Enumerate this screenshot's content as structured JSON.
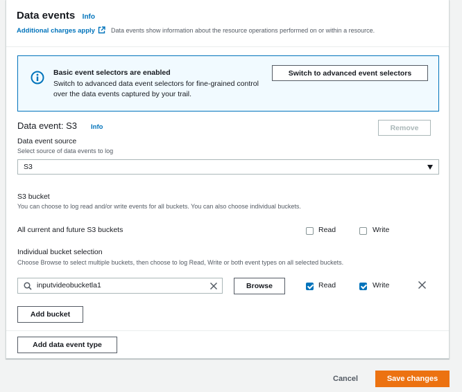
{
  "header": {
    "title": "Data events",
    "info": "Info",
    "charges_link": "Additional charges apply",
    "description": "Data events show information about the resource operations performed on or within a resource."
  },
  "alert": {
    "icon": "info-circle-icon",
    "title": "Basic event selectors are enabled",
    "body": "Switch to advanced data event selectors for fine-grained control over the data events captured by your trail.",
    "button": "Switch to advanced event selectors"
  },
  "data_event": {
    "title": "Data event: S3",
    "info": "Info",
    "remove_button": "Remove",
    "source_label": "Data event source",
    "source_desc": "Select source of data events to log",
    "source_value": "S3",
    "bucket_label": "S3 bucket",
    "bucket_desc": "You can choose to log read and/or write events for all buckets. You can also choose individual buckets.",
    "all_buckets_label": "All current and future S3 buckets",
    "all_read_label": "Read",
    "all_write_label": "Write",
    "all_read_checked": false,
    "all_write_checked": false,
    "individual_label": "Individual bucket selection",
    "individual_desc": "Choose Browse to select multiple buckets, then choose to log Read, Write or both event types on all selected buckets.",
    "bucket_value": "inputvideobucketla1",
    "browse_button": "Browse",
    "bucket_read_label": "Read",
    "bucket_write_label": "Write",
    "bucket_read_checked": true,
    "bucket_write_checked": true,
    "add_bucket_button": "Add bucket"
  },
  "footer_panel": {
    "add_type_button": "Add data event type"
  },
  "actions": {
    "cancel": "Cancel",
    "save": "Save changes"
  },
  "colors": {
    "link": "#0073bb",
    "primary": "#ec7211",
    "alert_bg": "#f1faff"
  }
}
